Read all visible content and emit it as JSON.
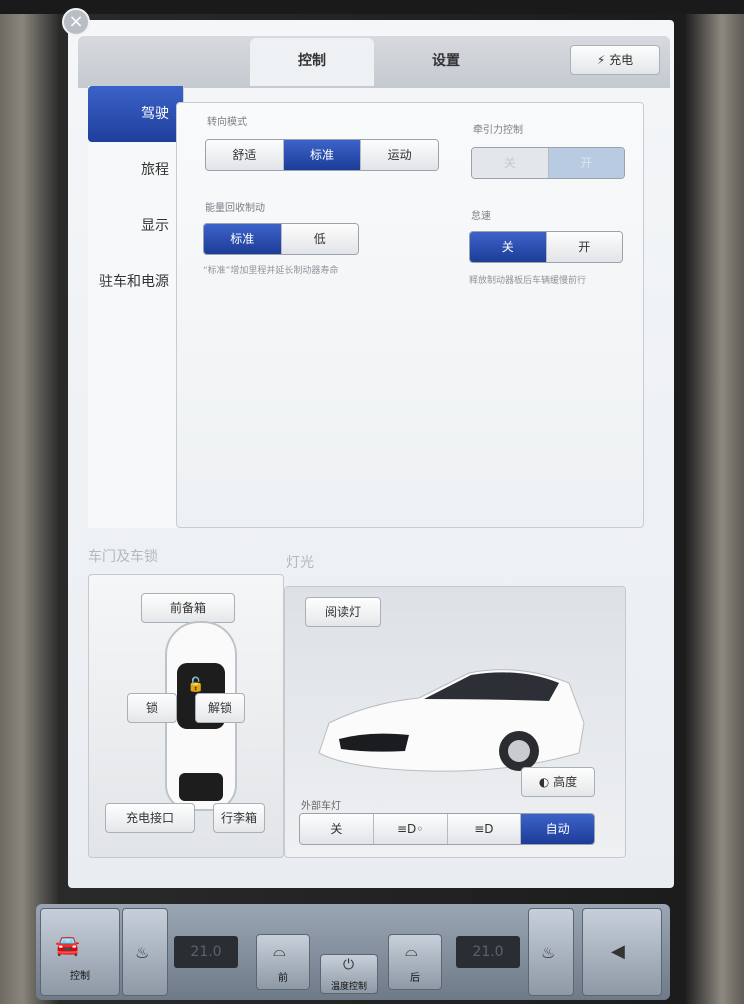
{
  "header": {
    "tabs": [
      {
        "label": "控制",
        "active": true
      },
      {
        "label": "设置",
        "active": false
      }
    ],
    "charge_button": "充电",
    "charge_icon": "plug-icon",
    "close_icon": "close-icon"
  },
  "sidebar": {
    "items": [
      {
        "label": "驾驶",
        "active": true
      },
      {
        "label": "旅程",
        "active": false
      },
      {
        "label": "显示",
        "active": false
      },
      {
        "label": "驻车和电源",
        "active": false
      }
    ]
  },
  "driving": {
    "steering_mode": {
      "label": "转向模式",
      "options": [
        "舒适",
        "标准",
        "运动"
      ],
      "selected": "标准"
    },
    "regen_braking": {
      "label": "能量回收制动",
      "options": [
        "标准",
        "低"
      ],
      "selected": "标准",
      "hint": "“标准”增加里程并延长制动器寿命"
    },
    "traction_control": {
      "label": "牵引力控制",
      "options": [
        "关",
        "开"
      ],
      "selected": "开",
      "disabled": true
    },
    "creep": {
      "label": "怠速",
      "options": [
        "关",
        "开"
      ],
      "selected": "关",
      "hint": "释放制动器板后车辆缓慢前行"
    }
  },
  "doors_section": {
    "title": "车门及车锁",
    "frunk": "前备箱",
    "lock": "锁",
    "unlock": "解锁",
    "charge_port": "充电接口",
    "trunk": "行李箱"
  },
  "lights_section": {
    "title": "灯光",
    "reading_light": "阅读灯",
    "height": "高度",
    "exterior_label": "外部车灯",
    "exterior_options": [
      "关",
      "≡D◦",
      "≡D",
      "自动"
    ],
    "selected": "自动"
  },
  "dock": {
    "control_label": "控制",
    "front_defrost": "前",
    "rear_defrost": "后",
    "climate_label": "温度控制",
    "left_temp": "21.0",
    "right_temp": "21.0"
  },
  "colors": {
    "accent": "#2447a8",
    "background": "#eef1f4"
  }
}
